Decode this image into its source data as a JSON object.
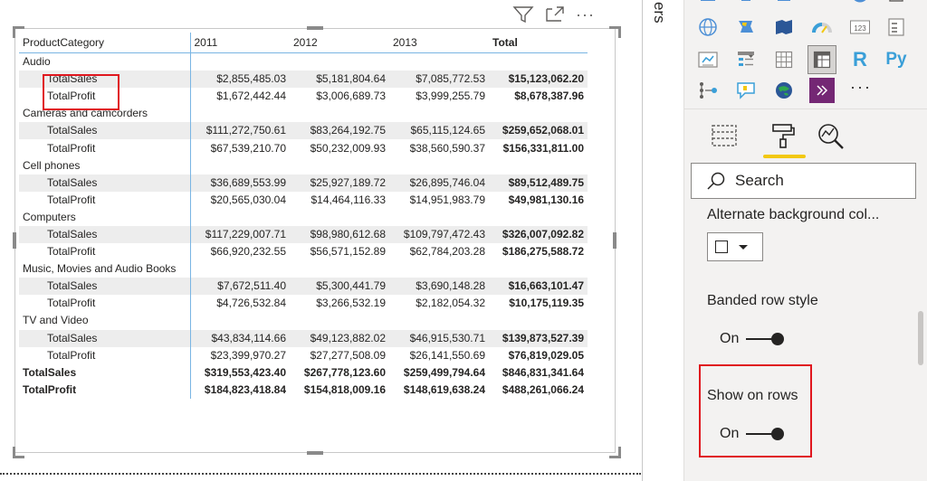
{
  "matrix": {
    "headers": [
      "ProductCategory",
      "2011",
      "2012",
      "2013",
      "Total"
    ],
    "rows": [
      {
        "kind": "cat",
        "label": "Audio"
      },
      {
        "kind": "sub",
        "label": "TotalSales",
        "values": [
          "$2,855,485.03",
          "$5,181,804.64",
          "$7,085,772.53"
        ],
        "total": "$15,123,062.20"
      },
      {
        "kind": "sub",
        "label": "TotalProfit",
        "values": [
          "$1,672,442.44",
          "$3,006,689.73",
          "$3,999,255.79"
        ],
        "total": "$8,678,387.96"
      },
      {
        "kind": "cat",
        "label": "Cameras and camcorders"
      },
      {
        "kind": "sub",
        "label": "TotalSales",
        "values": [
          "$111,272,750.61",
          "$83,264,192.75",
          "$65,115,124.65"
        ],
        "total": "$259,652,068.01"
      },
      {
        "kind": "sub",
        "label": "TotalProfit",
        "values": [
          "$67,539,210.70",
          "$50,232,009.93",
          "$38,560,590.37"
        ],
        "total": "$156,331,811.00"
      },
      {
        "kind": "cat",
        "label": "Cell phones"
      },
      {
        "kind": "sub",
        "label": "TotalSales",
        "values": [
          "$36,689,553.99",
          "$25,927,189.72",
          "$26,895,746.04"
        ],
        "total": "$89,512,489.75"
      },
      {
        "kind": "sub",
        "label": "TotalProfit",
        "values": [
          "$20,565,030.04",
          "$14,464,116.33",
          "$14,951,983.79"
        ],
        "total": "$49,981,130.16"
      },
      {
        "kind": "cat",
        "label": "Computers"
      },
      {
        "kind": "sub",
        "label": "TotalSales",
        "values": [
          "$117,229,007.71",
          "$98,980,612.68",
          "$109,797,472.43"
        ],
        "total": "$326,007,092.82"
      },
      {
        "kind": "sub",
        "label": "TotalProfit",
        "values": [
          "$66,920,232.55",
          "$56,571,152.89",
          "$62,784,203.28"
        ],
        "total": "$186,275,588.72"
      },
      {
        "kind": "cat",
        "label": "Music, Movies and Audio Books"
      },
      {
        "kind": "sub",
        "label": "TotalSales",
        "values": [
          "$7,672,511.40",
          "$5,300,441.79",
          "$3,690,148.28"
        ],
        "total": "$16,663,101.47"
      },
      {
        "kind": "sub",
        "label": "TotalProfit",
        "values": [
          "$4,726,532.84",
          "$3,266,532.19",
          "$2,182,054.32"
        ],
        "total": "$10,175,119.35"
      },
      {
        "kind": "cat",
        "label": "TV and Video"
      },
      {
        "kind": "sub",
        "label": "TotalSales",
        "values": [
          "$43,834,114.66",
          "$49,123,882.02",
          "$46,915,530.71"
        ],
        "total": "$139,873,527.39"
      },
      {
        "kind": "sub",
        "label": "TotalProfit",
        "values": [
          "$23,399,970.27",
          "$27,277,508.09",
          "$26,141,550.69"
        ],
        "total": "$76,819,029.05"
      },
      {
        "kind": "grand",
        "label": "TotalSales",
        "values": [
          "$319,553,423.40",
          "$267,778,123.60",
          "$259,499,794.64"
        ],
        "total": "$846,831,341.64"
      },
      {
        "kind": "grand",
        "label": "TotalProfit",
        "values": [
          "$184,823,418.84",
          "$154,818,009.16",
          "$148,619,638.24"
        ],
        "total": "$488,261,066.24"
      }
    ]
  },
  "visual_toolbar": {
    "icons": [
      "filter-icon",
      "focus-mode-icon",
      "more-options-icon"
    ],
    "more_label": "···"
  },
  "collapsed_pane": {
    "label": "ers"
  },
  "visualizations": {
    "more_label": "···",
    "icons": [
      "filled-map-icon",
      "shape-map-icon",
      "azure-map-icon",
      "gauge-icon",
      "card-icon",
      "multi-row-card-icon",
      "kpi-icon",
      "slicer-icon",
      "table-icon",
      "matrix-icon",
      "r-visual-icon",
      "python-visual-icon",
      "key-influencers-icon",
      "qna-icon",
      "arcgis-icon",
      "power-apps-icon"
    ],
    "r_label": "R",
    "py_label": "Py",
    "card_label": "123"
  },
  "tabs": [
    "fields-tab",
    "format-tab",
    "analytics-tab"
  ],
  "search": {
    "placeholder": "Search"
  },
  "format": {
    "alt_background_label": "Alternate background col...",
    "banded_row_label": "Banded row style",
    "banded_row_state": "On",
    "show_on_rows_label": "Show on rows",
    "show_on_rows_state": "On"
  },
  "colors": {
    "accent": "#f2c811",
    "highlight": "#e0161e",
    "grid_line": "#79b5e3",
    "band": "#ededed"
  }
}
